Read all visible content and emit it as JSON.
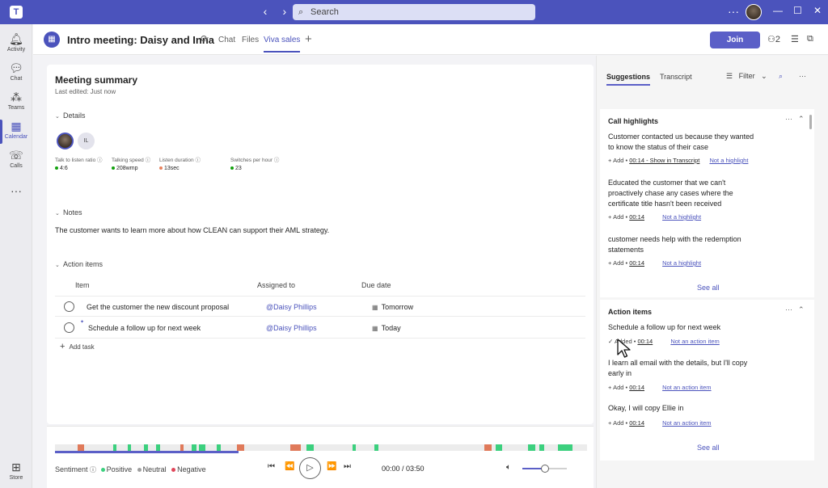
{
  "topbar": {
    "search_placeholder": "Search",
    "back_glyph": "‹",
    "forward_glyph": "›",
    "more_glyph": "···",
    "minimize": "—",
    "maximize": "☐",
    "close": "✕"
  },
  "rail": [
    {
      "label": "Activity",
      "icon": "bell-icon",
      "glyph": "🔔︎"
    },
    {
      "label": "Chat",
      "icon": "chat-icon",
      "glyph": "💬︎"
    },
    {
      "label": "Teams",
      "icon": "teams-icon",
      "glyph": "⁂"
    },
    {
      "label": "Calendar",
      "icon": "calendar-icon",
      "glyph": "▦"
    },
    {
      "label": "Calls",
      "icon": "phone-icon",
      "glyph": "☏"
    },
    {
      "label": "",
      "icon": "more-icon",
      "glyph": "···"
    },
    {
      "label": "Store",
      "icon": "store-icon",
      "glyph": "⊞"
    }
  ],
  "header": {
    "title": "Intro meeting: Daisy and Inna",
    "tabs": [
      "Chat",
      "Files",
      "Viva sales"
    ],
    "active_tab": "Viva sales",
    "join_label": "Join",
    "participants_count": "2"
  },
  "summary": {
    "title": "Meeting summary",
    "last_edited": "Last edited: Just now",
    "details_label": "Details",
    "participant_initials": "IL",
    "metrics": [
      {
        "label": "Talk to listen ratio",
        "value": "4:6",
        "color": "#13a10e"
      },
      {
        "label": "Talking speed",
        "value": "208wmp",
        "color": "#13a10e"
      },
      {
        "label": "Listen duration",
        "value": "13sec",
        "color": "#e8825d"
      },
      {
        "label": "Switches per hour",
        "value": "23",
        "color": "#13a10e"
      }
    ],
    "notes_label": "Notes",
    "notes_text": "The customer wants to learn more about how CLEAN can support their AML strategy.",
    "action_items_label": "Action items",
    "columns": [
      "Item",
      "Assigned to",
      "Due date"
    ],
    "rows": [
      {
        "item": "Get the customer the new discount proposal",
        "assignee": "@Daisy Phillips",
        "due": "Tomorrow"
      },
      {
        "item": "Schedule a follow up for next week",
        "assignee": "@Daisy Phillips",
        "due": "Today"
      }
    ],
    "add_task": "Add task"
  },
  "player": {
    "sentiment_label": "Sentiment",
    "positive": "Positive",
    "neutral": "Neutral",
    "negative": "Negative",
    "time": "00:00 / 03:50",
    "progress": 0.345,
    "volume": 0.5,
    "colors": {
      "positive": "#3cd07e",
      "negative": "#e07a5a",
      "neutral": "#9e9e9e"
    }
  },
  "right": {
    "tabs": [
      "Suggestions",
      "Transcript"
    ],
    "filter_label": "Filter",
    "call_highlights": {
      "title": "Call highlights",
      "items": [
        {
          "text": "Customer contacted us because they wanted to know the status of their case",
          "add": "Add",
          "time": "00:14 - Show in Transcript",
          "reject": "Not a highlight"
        },
        {
          "text": "Educated the customer that we can't proactively chase any cases where the certificate title hasn't been received",
          "add": "Add",
          "time": "00:14",
          "reject": "Not a highlight"
        },
        {
          "text": "customer needs help with the redemption statements",
          "add": "Add",
          "time": "00:14",
          "reject": "Not a highlight"
        }
      ],
      "see_all": "See all"
    },
    "action_items": {
      "title": "Action items",
      "items": [
        {
          "text": "Schedule a follow up for next week",
          "add": "Added",
          "time": "00:14",
          "reject": "Not an action item"
        },
        {
          "text": "I learn all email with the details, but I'll copy early in",
          "add": "Add",
          "time": "00:14",
          "reject": "Not an action item"
        },
        {
          "text": "Okay, I will copy Ellie in",
          "add": "Add",
          "time": "00:14",
          "reject": "Not an action item"
        }
      ],
      "see_all": "See all"
    }
  }
}
